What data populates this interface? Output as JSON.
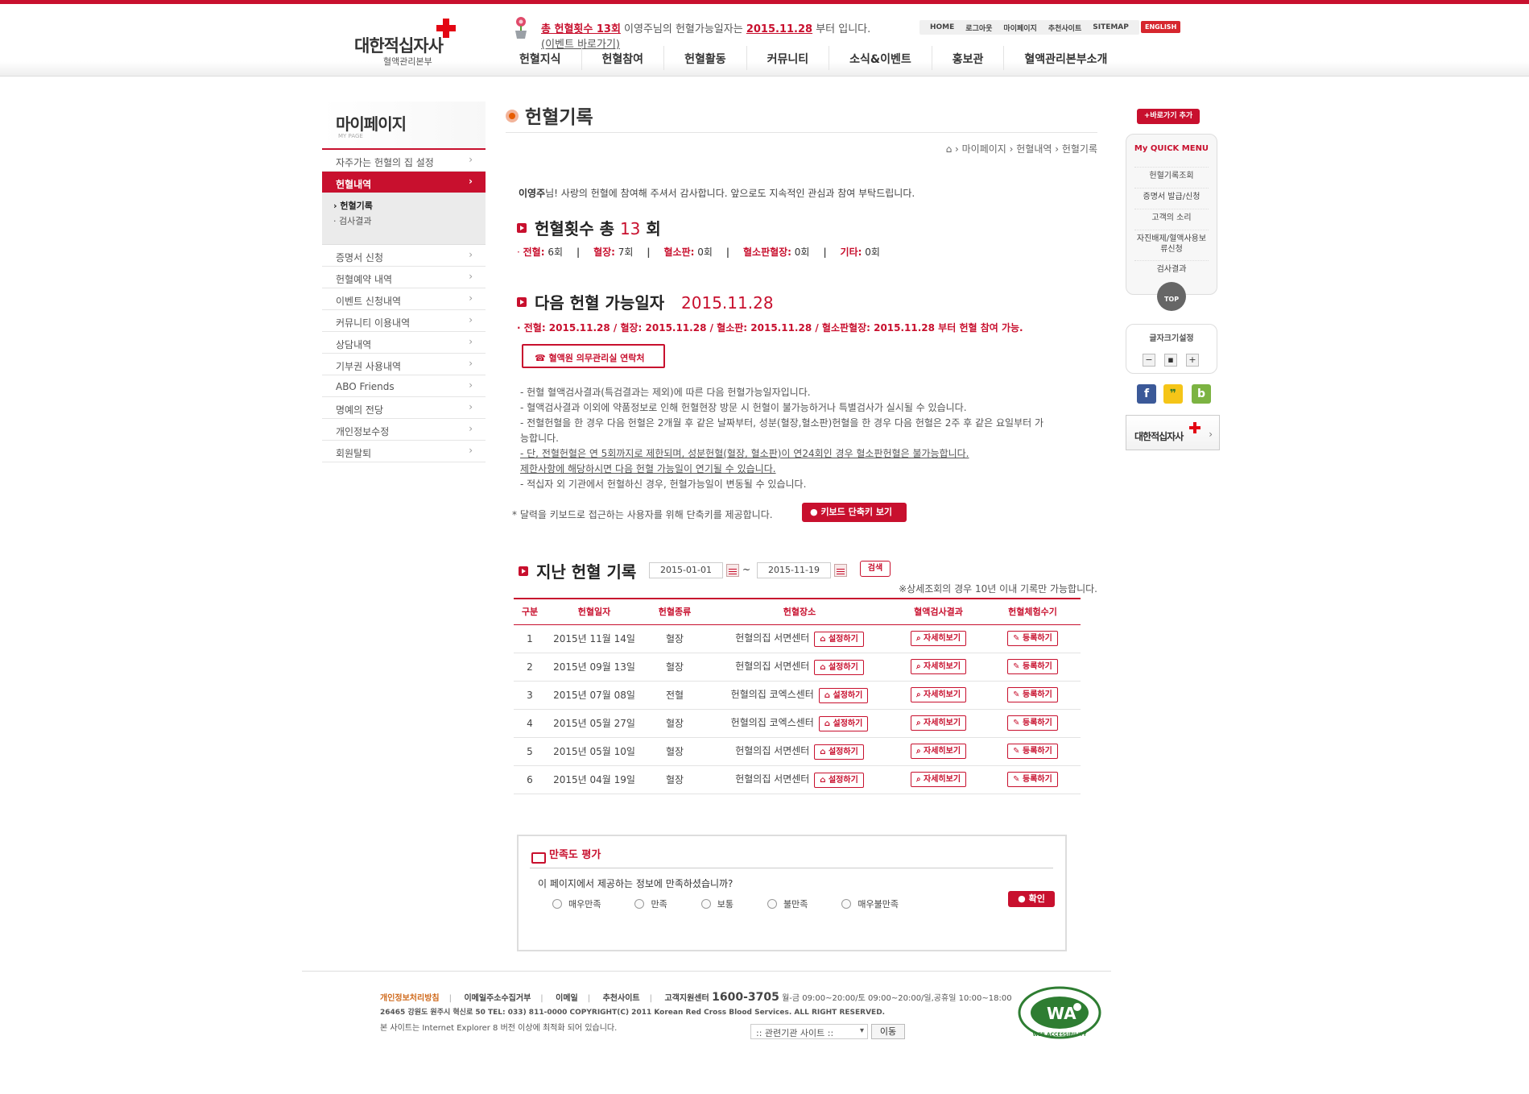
{
  "header": {
    "logo_name": "대한적십자사",
    "logo_sub": "혈액관리본부",
    "notice_prefix": "총 헌혈횟수 13회",
    "notice_mid": " 이영주님의 헌혈가능일자는 ",
    "notice_date": "2015.11.28",
    "notice_suffix": " 부터 입니다.",
    "event_link": "(이벤트 바로가기)",
    "utility": [
      "HOME",
      "로그아웃",
      "마이페이지",
      "추천사이트",
      "SITEMAP"
    ],
    "english": "ENGLISH",
    "gnb": [
      "헌혈지식",
      "헌혈참여",
      "헌혈활동",
      "커뮤니티",
      "소식&이벤트",
      "홍보관",
      "혈액관리본부소개"
    ]
  },
  "lnb": {
    "title": "마이페이지",
    "title_en": "MY PAGE",
    "item_top": "자주가는 헌혈의 집 설정",
    "item_active": "헌혈내역",
    "subs": [
      "› 헌혈기록",
      "· 검사결과"
    ],
    "items": [
      "증명서 신청",
      "헌혈예약 내역",
      "이벤트 신청내역",
      "커뮤니티 이용내역",
      "상담내역",
      "기부권 사용내역",
      "ABO Friends",
      "명예의 전당",
      "개인정보수정",
      "회원탈퇴"
    ]
  },
  "content": {
    "title": "헌혈기록",
    "breadcrumb": "⌂  ›  마이페이지  ›  헌혈내역  ›  헌혈기록",
    "greet_name": "이영주",
    "greet_rest": "님! 사랑의 헌혈에 참여해 주셔서 감사합니다. 앞으로도 지속적인 관심과 참여 부탁드립니다.",
    "count_label": "헌혈횟수 총 ",
    "count_num": "13",
    "count_unit": " 회",
    "summary": [
      {
        "k": "전혈:",
        "v": " 6회"
      },
      {
        "k": "혈장:",
        "v": " 7회"
      },
      {
        "k": "혈소판:",
        "v": " 0회"
      },
      {
        "k": "혈소판혈장:",
        "v": " 0회"
      },
      {
        "k": "기타:",
        "v": " 0회"
      }
    ],
    "next_label": "다음 헌혈 가능일자",
    "next_date": "2015.11.28",
    "next_line": "전혈: 2015.11.28 / 혈장: 2015.11.28 / 혈소판: 2015.11.28 / 혈소판혈장: 2015.11.28 부터 헌혈 참여 가능.",
    "call_button": "☎  혈액원 의무관리실 연락처",
    "notes": [
      "- 헌혈 혈액검사결과(특검결과는 제외)에 따른 다음 헌혈가능일자입니다.",
      "- 혈액검사결과 이외에 약품정보로 인해 헌혈현장 방문 시 헌혈이 불가능하거나 특별검사가 실시될 수 있습니다.",
      "- 전혈헌혈을 한 경우 다음 헌혈은 2개월 후 같은 날짜부터, 성분(혈장,혈소판)헌혈을 한 경우 다음 헌혈은 2주 후 같은 요일부터 가능합니다.",
      "- 단, 전혈헌혈은 연 5회까지로 제한되며, 성분헌혈(혈장, 혈소판)이 연24회인 경우 혈소판헌혈은 불가능합니다.",
      "제한사항에 해당하시면 다음 헌혈 가능일이 연기될 수 있습니다.",
      "- 적십자 외 기관에서 헌혈하신 경우, 헌혈가능일이 변동될 수 있습니다."
    ],
    "kbd_text": "* 달력을 키보드로 접근하는 사용자를 위해 단축키를 제공합니다.",
    "kbd_button": "키보드 단축키 보기",
    "past_title": "지난 헌혈 기록",
    "date_from": "2015-01-01",
    "date_to": "2015-11-19",
    "tilde": "~",
    "search_button": "검색",
    "note_right": "※상세조회의 경우 10년 이내 기록만 가능합니다.",
    "table_headers": [
      "구분",
      "헌혈일자",
      "헌혈종류",
      "헌혈장소",
      "혈액검사결과",
      "헌혈체험수기"
    ],
    "set_button": "⌂ 설정하기",
    "detail_button": "⌕ 자세히보기",
    "register_button": "✎ 등록하기",
    "rows": [
      {
        "no": "1",
        "date": "2015년 11월 14일",
        "type": "혈장",
        "place": "헌혈의집 서면센터"
      },
      {
        "no": "2",
        "date": "2015년 09월 13일",
        "type": "혈장",
        "place": "헌혈의집 서면센터"
      },
      {
        "no": "3",
        "date": "2015년 07월 08일",
        "type": "전혈",
        "place": "헌혈의집 코엑스센터"
      },
      {
        "no": "4",
        "date": "2015년 05월 27일",
        "type": "혈장",
        "place": "헌혈의집 코엑스센터"
      },
      {
        "no": "5",
        "date": "2015년 05월 10일",
        "type": "혈장",
        "place": "헌혈의집 서면센터"
      },
      {
        "no": "6",
        "date": "2015년 04월 19일",
        "type": "혈장",
        "place": "헌혈의집 서면센터"
      }
    ],
    "survey_title": "만족도 평가",
    "survey_q": "이 페이지에서 제공하는 정보에 만족하셨습니까?",
    "survey_opts": [
      "매우만족",
      "만족",
      "보통",
      "불만족",
      "매우불만족"
    ],
    "survey_ok": "확인"
  },
  "quick": {
    "add_fav": "+바로가기 추가",
    "title": "My QUICK MENU",
    "items": [
      "헌혈기록조회",
      "증명서 발급/신청",
      "고객의 소리",
      "자진배제/혈액사용보류신청",
      "검사결과"
    ],
    "top": "TOP",
    "font_title": "글자크기설정",
    "font_btns": [
      "−",
      "▪",
      "+"
    ],
    "sns": [
      "f",
      "❞",
      "b"
    ],
    "banner": "대한적십자사",
    "banner_arrow": "›"
  },
  "footer": {
    "links": [
      "개인정보처리방침",
      "이메일주소수집거부",
      "이메일",
      "추천사이트"
    ],
    "center_label": "고객지원센터 ",
    "tel": "1600-3705",
    "hours": " 월-금 09:00~20:00/토 09:00~20:00/일,공휴일 10:00~18:00",
    "addr": "26465 강원도 원주시 혁신로 50  TEL: 033) 811-0000  COPYRIGHT(C) 2011 Korean Red Cross Blood Services. ALL RIGHT RESERVED.",
    "best": "본 사이트는 Internet Explorer 8 버전 이상에 최적화 되어 있습니다.",
    "related": ":: 관련기관 사이트 ::",
    "go": "이동",
    "wa_text": "WA",
    "wa_ring": "WEB ACCESSIBILITY"
  },
  "colors": {
    "brand_red": "#c8102e",
    "cross_red": "#e30613"
  }
}
